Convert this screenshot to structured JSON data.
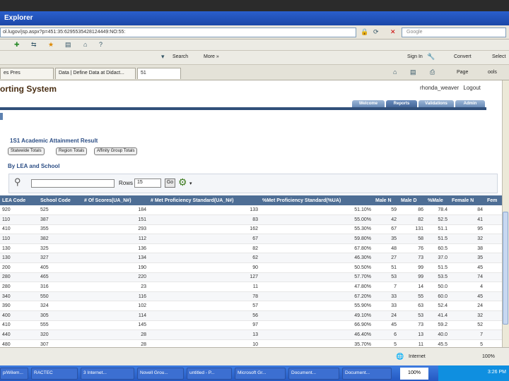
{
  "browser": {
    "title": "Explorer",
    "address": "ol.lugov/jsp.aspx?p=451:35:6295535428124449:NO:55:",
    "search_placeholder": "Google",
    "toolbar_search": "Search",
    "toolbar_more": "More »",
    "sign_in": "Sign In",
    "convert": "Convert",
    "select": "Select",
    "page_menu": "Page",
    "tools_menu": "ools",
    "tabs": [
      {
        "label": "es Pres"
      },
      {
        "label": "Data | Define Data at Didact..."
      },
      {
        "label": "51"
      }
    ]
  },
  "app": {
    "title": "orting System",
    "user_link": "rhonda_weaver",
    "logout": "Logout",
    "nav_tabs": [
      {
        "label": "Welcome"
      },
      {
        "label": "Reports"
      },
      {
        "label": "Validations"
      },
      {
        "label": "Admin"
      }
    ],
    "section_title": "1S1 Academic Attainment Result",
    "filter_buttons": [
      {
        "label": "Statewide Totals"
      },
      {
        "label": "Region Totals"
      },
      {
        "label": "Affinity Group Totals"
      }
    ],
    "subsection": "By LEA and School",
    "rows_label": "Rows",
    "rows_value": "15",
    "go_label": "Go"
  },
  "table": {
    "columns": [
      "LEA Code",
      "School Code",
      "# Of Scores(UA_N#)",
      "# Met Proficiency Standard(UA_N#)",
      "%Met Proficiency Standard(%UA)",
      "Male N",
      "Male D",
      "%Male",
      "Female N",
      "Fem"
    ],
    "rows": [
      [
        "920",
        "525",
        "184",
        "133",
        "51.10%",
        "59",
        "86",
        "78.4",
        "84",
        ""
      ],
      [
        "110",
        "387",
        "151",
        "83",
        "55.00%",
        "42",
        "82",
        "52.5",
        "41",
        ""
      ],
      [
        "410",
        "355",
        "293",
        "162",
        "55.30%",
        "67",
        "131",
        "51.1",
        "95",
        ""
      ],
      [
        "110",
        "382",
        "112",
        "67",
        "59.80%",
        "35",
        "58",
        "51.5",
        "32",
        ""
      ],
      [
        "130",
        "325",
        "136",
        "82",
        "67.80%",
        "48",
        "76",
        "60.5",
        "38",
        ""
      ],
      [
        "130",
        "327",
        "134",
        "62",
        "46.30%",
        "27",
        "73",
        "37.0",
        "35",
        ""
      ],
      [
        "200",
        "405",
        "190",
        "90",
        "50.50%",
        "51",
        "99",
        "51.5",
        "45",
        ""
      ],
      [
        "280",
        "465",
        "220",
        "127",
        "57.70%",
        "53",
        "99",
        "53.5",
        "74",
        ""
      ],
      [
        "280",
        "316",
        "23",
        "11",
        "47.80%",
        "7",
        "14",
        "50.0",
        "4",
        ""
      ],
      [
        "340",
        "550",
        "116",
        "78",
        "67.20%",
        "33",
        "55",
        "60.0",
        "45",
        ""
      ],
      [
        "390",
        "324",
        "102",
        "57",
        "55.90%",
        "33",
        "63",
        "52.4",
        "24",
        ""
      ],
      [
        "400",
        "305",
        "114",
        "56",
        "49.10%",
        "24",
        "53",
        "41.4",
        "32",
        ""
      ],
      [
        "410",
        "555",
        "145",
        "97",
        "66.90%",
        "45",
        "73",
        "59.2",
        "52",
        ""
      ],
      [
        "440",
        "320",
        "28",
        "13",
        "46.40%",
        "6",
        "13",
        "40.0",
        "7",
        ""
      ],
      [
        "480",
        "307",
        "28",
        "10",
        "35.70%",
        "5",
        "11",
        "45.5",
        "5",
        ""
      ]
    ]
  },
  "status": {
    "zone": "Internet",
    "zoom": "100%"
  },
  "taskbar": {
    "items": [
      {
        "label": "p/Wilem..."
      },
      {
        "label": "RACTEC"
      },
      {
        "label": "3 Internet..."
      },
      {
        "label": "Novell Grou..."
      },
      {
        "label": "untitled - P..."
      },
      {
        "label": "Microsoft Gr..."
      },
      {
        "label": "Document..."
      },
      {
        "label": "Document..."
      }
    ],
    "tray_zoom": "100%",
    "clock": "3:26 PM"
  }
}
